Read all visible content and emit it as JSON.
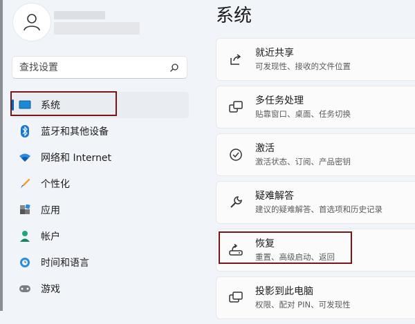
{
  "search": {
    "placeholder": "查找设置"
  },
  "sidebar": {
    "items": [
      {
        "label": "系统",
        "icon": "monitor-icon"
      },
      {
        "label": "蓝牙和其他设备",
        "icon": "bluetooth-icon"
      },
      {
        "label": "网络和 Internet",
        "icon": "wifi-icon"
      },
      {
        "label": "个性化",
        "icon": "brush-icon"
      },
      {
        "label": "应用",
        "icon": "apps-icon"
      },
      {
        "label": "帐户",
        "icon": "person-icon"
      },
      {
        "label": "时间和语言",
        "icon": "globe-clock-icon"
      },
      {
        "label": "游戏",
        "icon": "gamepad-icon"
      }
    ]
  },
  "main": {
    "title": "系统",
    "cards": [
      {
        "title": "就近共享",
        "subtitle": "可发现性、接收的文件位置",
        "icon": "share-icon"
      },
      {
        "title": "多任务处理",
        "subtitle": "贴靠窗口、桌面、任务切换",
        "icon": "multitask-icon"
      },
      {
        "title": "激活",
        "subtitle": "激活状态、订阅、产品密钥",
        "icon": "check-circle-icon"
      },
      {
        "title": "疑难解答",
        "subtitle": "建议的疑难解答、首选项和历史记录",
        "icon": "wrench-icon"
      },
      {
        "title": "恢复",
        "subtitle": "重置、高级启动、返回",
        "icon": "recovery-icon"
      },
      {
        "title": "投影到此电脑",
        "subtitle": "权限、配对 PIN、可发现性",
        "icon": "project-icon"
      }
    ]
  },
  "colors": {
    "accent": "#0067c0",
    "highlight_box": "#7a1414"
  }
}
